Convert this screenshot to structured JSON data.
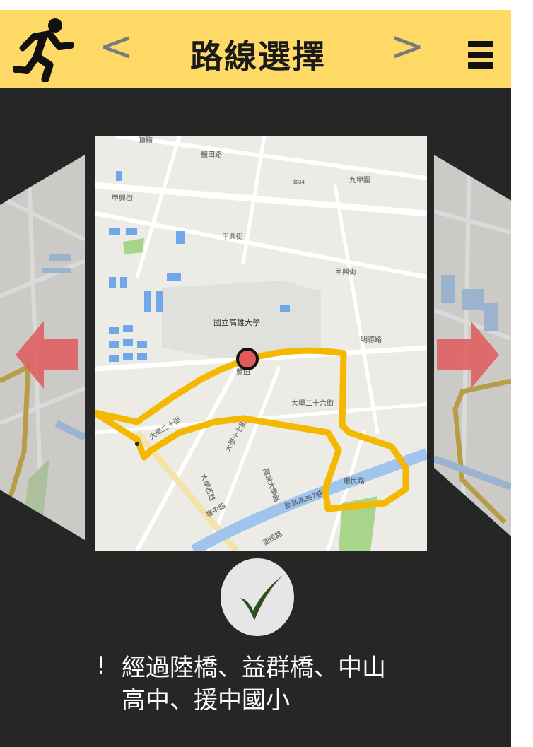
{
  "header": {
    "title": "路線選擇",
    "prev_label": "<",
    "next_label": ">",
    "runner_icon": "running-person-icon",
    "menu_icon": "hamburger-menu-icon",
    "background": "#ffd966"
  },
  "map": {
    "place_labels": [
      "頂鹽",
      "鹽田路",
      "九甲圍",
      "甲興街",
      "甲興街",
      "甲興街",
      "國立高雄大學",
      "明德路",
      "藍田",
      "大學二十六街",
      "大學二十街",
      "大學十七街",
      "高雄大學路",
      "大學西路",
      "藍昌路367巷",
      "惠民路",
      "援中路",
      "德民路",
      "高34"
    ],
    "route_color": "#f5b800",
    "start_marker_color": "#e05a5a"
  },
  "arrows": {
    "left_icon": "left-arrow-icon",
    "right_icon": "right-arrow-icon",
    "color": "#e06060"
  },
  "confirm": {
    "icon": "checkmark-icon",
    "color": "#2f4f1f"
  },
  "note": {
    "bang": "!",
    "line1": "經過陸橋、益群橋、中山",
    "line2": "高中、援中國小"
  }
}
